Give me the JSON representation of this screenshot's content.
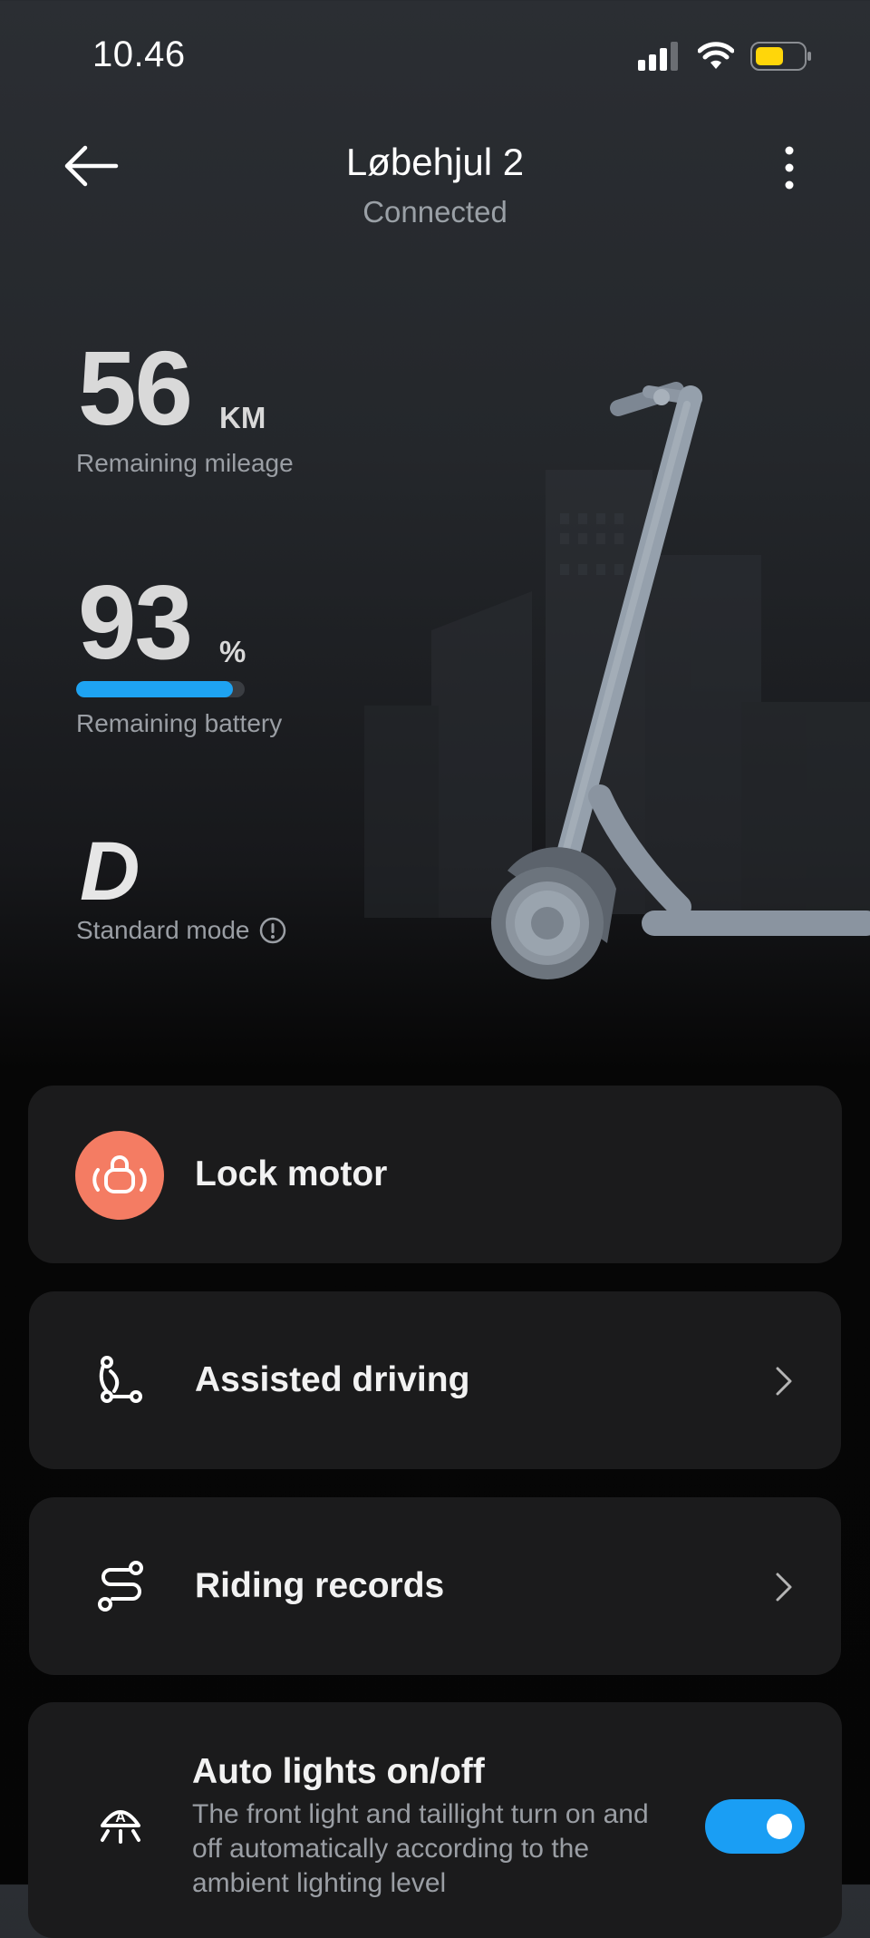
{
  "status": {
    "time": "10.46"
  },
  "header": {
    "title": "Løbehjul 2",
    "subtitle": "Connected"
  },
  "stats": {
    "mileage_value": "56",
    "mileage_unit": "KM",
    "mileage_label": "Remaining mileage",
    "battery_value": "93",
    "battery_unit": "%",
    "battery_level": 0.93,
    "battery_label": "Remaining battery",
    "mode_letter": "D",
    "mode_label": "Standard mode"
  },
  "cards": {
    "lock": {
      "label": "Lock motor"
    },
    "assisted": {
      "label": "Assisted driving"
    },
    "records": {
      "label": "Riding records"
    },
    "lights": {
      "label": "Auto lights on/off",
      "description": "The front light and taillight turn on and off automatically according to the ambient lighting level",
      "enabled": true
    }
  },
  "colors": {
    "accent": "#1ea3f2",
    "lock": "#f47c63",
    "battery_fill": "#1ea3f2"
  },
  "icons": [
    "back-arrow-icon",
    "more-vertical-icon",
    "signal-icon",
    "wifi-icon",
    "battery-icon",
    "info-icon",
    "lock-icon",
    "assisted-driving-icon",
    "riding-records-icon",
    "auto-lights-icon",
    "chevron-right-icon"
  ]
}
